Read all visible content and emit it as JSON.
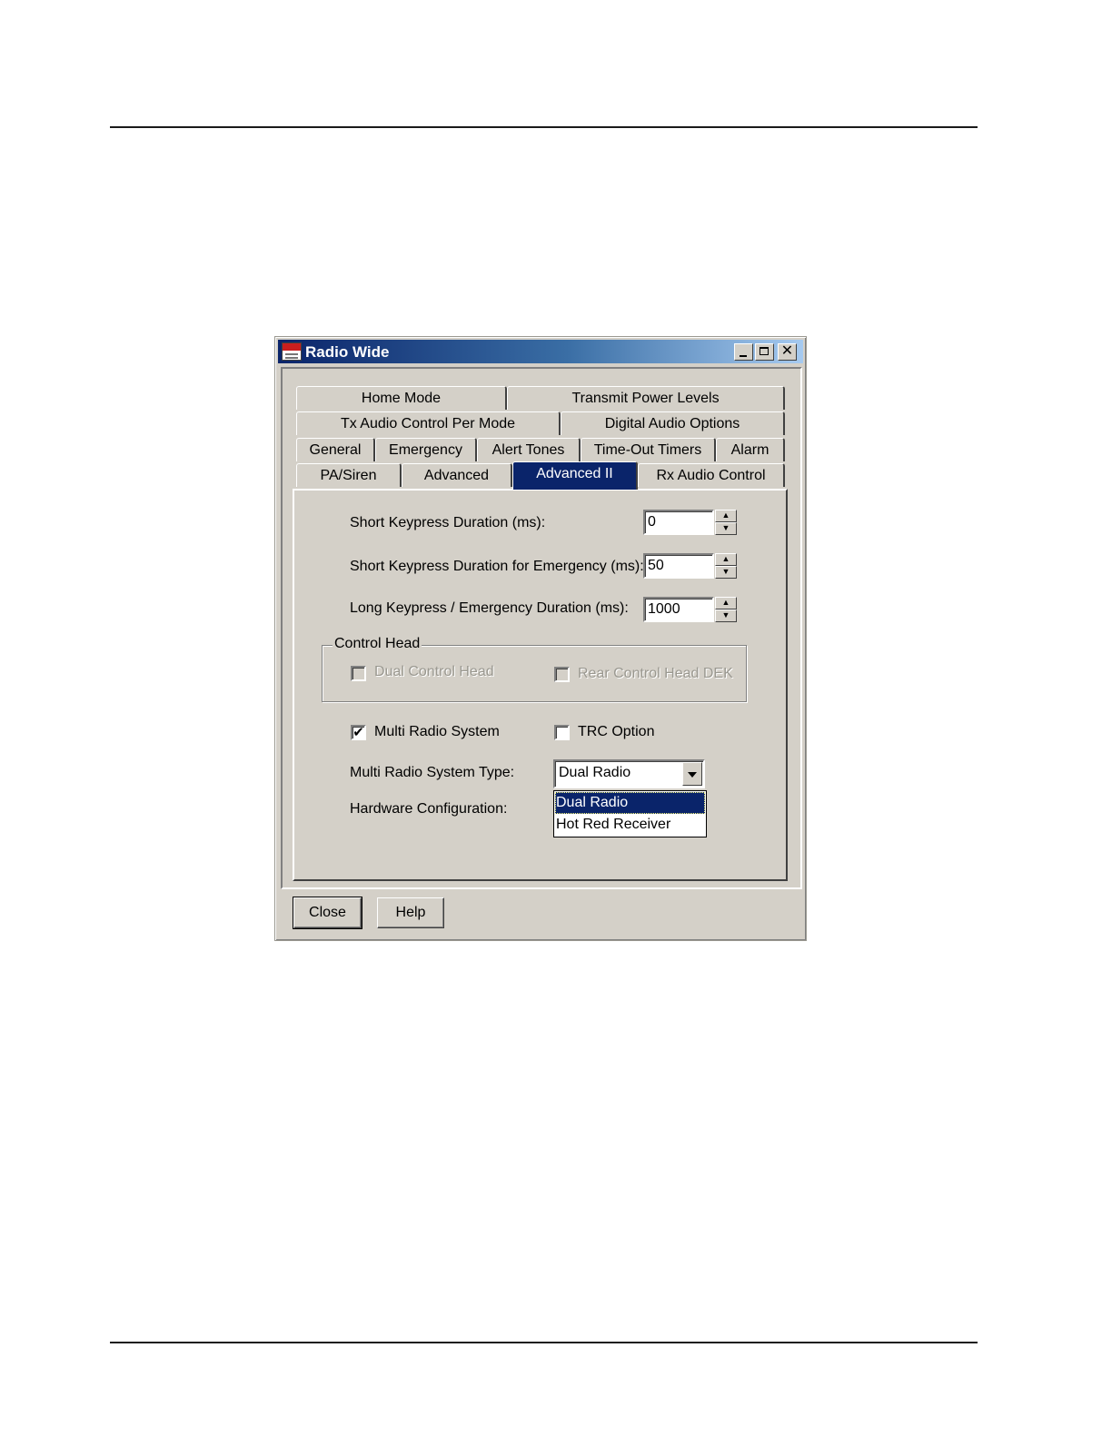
{
  "window": {
    "title": "Radio Wide"
  },
  "tabs": {
    "row1": [
      "Home Mode",
      "Transmit Power Levels"
    ],
    "row2": [
      "Tx Audio Control Per Mode",
      "Digital Audio Options"
    ],
    "row3": [
      "General",
      "Emergency",
      "Alert Tones",
      "Time-Out Timers",
      "Alarm"
    ],
    "row4": [
      "PA/Siren",
      "Advanced",
      "Advanced II",
      "Rx Audio Control"
    ],
    "active": "Advanced II"
  },
  "fields": {
    "short_keypress": {
      "label": "Short Keypress Duration (ms):",
      "value": "0"
    },
    "short_keypress_emergency": {
      "label": "Short Keypress Duration for Emergency (ms):",
      "value": "50"
    },
    "long_keypress": {
      "label": "Long Keypress / Emergency Duration (ms):",
      "value": "1000"
    }
  },
  "control_head": {
    "legend": "Control Head",
    "dual_control_head": {
      "label": "Dual Control Head",
      "checked": false,
      "enabled": false
    },
    "rear_control_head_dek": {
      "label": "Rear Control Head DEK",
      "checked": false,
      "enabled": false
    }
  },
  "options": {
    "multi_radio_system": {
      "label": "Multi Radio System",
      "checked": true
    },
    "trc_option": {
      "label": "TRC Option",
      "checked": false
    }
  },
  "multi_radio_type": {
    "label": "Multi Radio System Type:",
    "value": "Dual Radio",
    "options": [
      "Dual Radio",
      "Hot Red Receiver"
    ]
  },
  "hardware_config": {
    "label": "Hardware Configuration:"
  },
  "buttons": {
    "close": "Close",
    "help": "Help"
  },
  "glyphs": {
    "check": "✔",
    "close_x": "✕",
    "spin_up": "▲",
    "spin_down": "▼"
  }
}
